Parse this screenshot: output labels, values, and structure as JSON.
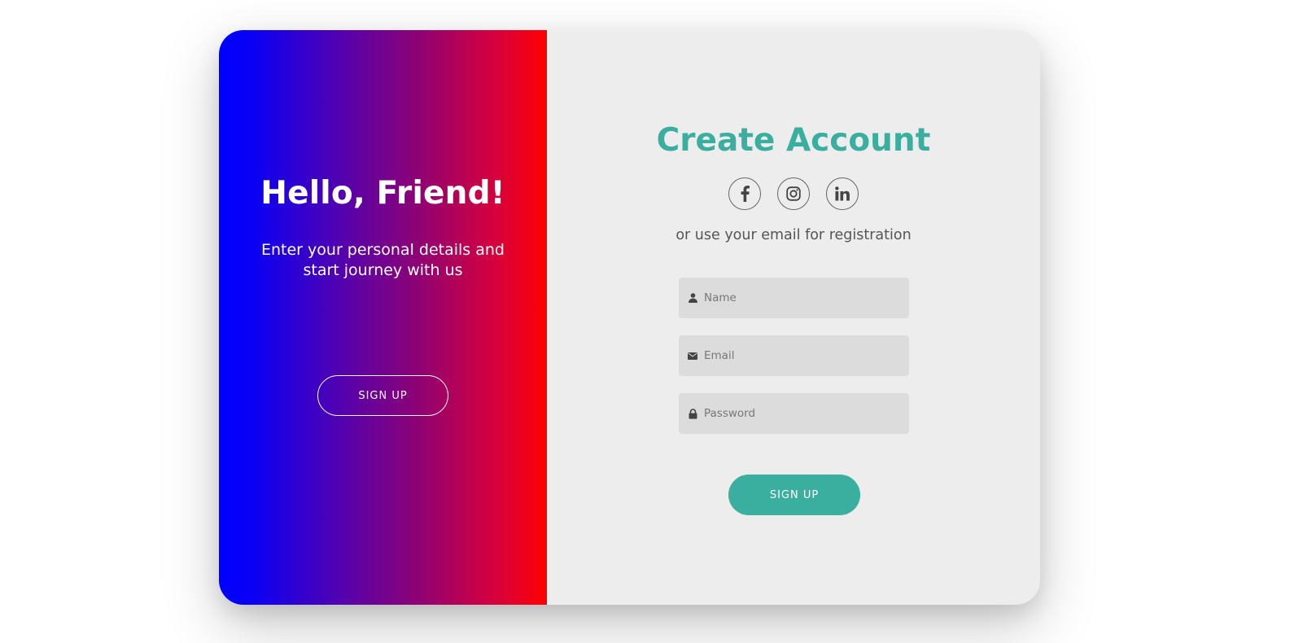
{
  "left_panel": {
    "heading": "Hello, Friend!",
    "subtext": "Enter your personal details and start journey with us",
    "button_label": "SIGN UP"
  },
  "right_panel": {
    "title": "Create Account",
    "socials": [
      {
        "icon": "facebook-icon"
      },
      {
        "icon": "instagram-icon"
      },
      {
        "icon": "linkedin-icon"
      }
    ],
    "hint": "or use your email for registration",
    "fields": {
      "name": {
        "placeholder": "Name",
        "value": "",
        "icon": "user-icon"
      },
      "email": {
        "placeholder": "Email",
        "value": "",
        "icon": "envelope-icon"
      },
      "password": {
        "placeholder": "Password",
        "value": "",
        "icon": "lock-icon"
      }
    },
    "submit_label": "SIGN UP"
  },
  "colors": {
    "accent": "#3aafa0",
    "gradient_start": "#0000ff",
    "gradient_end": "#ff0000",
    "panel_bg": "#ededed",
    "field_bg": "#dcdcdc"
  }
}
